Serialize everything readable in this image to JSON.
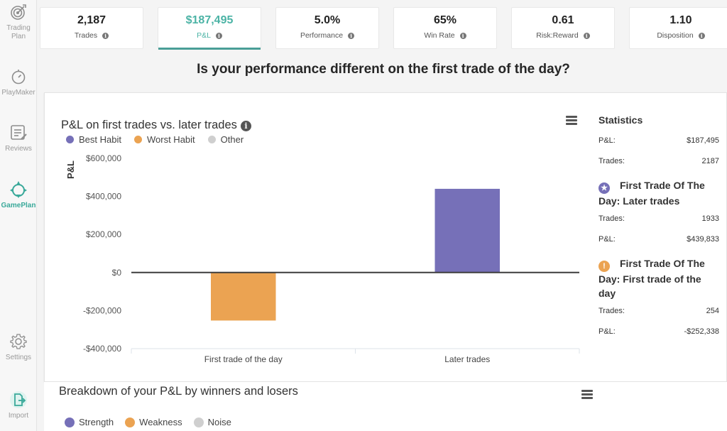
{
  "sidebar": {
    "items": [
      {
        "label": "Trading Plan",
        "icon": "target-icon",
        "active": false
      },
      {
        "label": "PlayMaker",
        "icon": "stopwatch-icon",
        "active": false
      },
      {
        "label": "Reviews",
        "icon": "review-list-icon",
        "active": false
      },
      {
        "label": "GamePlan",
        "icon": "compass-icon",
        "active": true
      },
      {
        "label": "Settings",
        "icon": "gear-icon",
        "active": false
      },
      {
        "label": "Import",
        "icon": "import-file-icon",
        "active": false
      }
    ]
  },
  "metrics": [
    {
      "value": "2,187",
      "label": "Trades",
      "active": false
    },
    {
      "value": "$187,495",
      "label": "P&L",
      "active": true
    },
    {
      "value": "5.0%",
      "label": "Performance",
      "active": false
    },
    {
      "value": "65%",
      "label": "Win Rate",
      "active": false
    },
    {
      "value": "0.61",
      "label": "Risk:Reward",
      "active": false
    },
    {
      "value": "1.10",
      "label": "Disposition",
      "active": false
    }
  ],
  "page_heading": "Is your performance different on the first trade of the day?",
  "colors": {
    "accent": "#4bb3a5",
    "best_habit": "#7670b8",
    "worst_habit": "#eba352",
    "other": "#cfcfcf"
  },
  "chart_data": {
    "type": "bar",
    "title": "P&L on first trades vs. later trades",
    "xlabel": "",
    "ylabel": "P&L",
    "categories": [
      "First trade of the day",
      "Later trades"
    ],
    "values": [
      -252338,
      439833
    ],
    "bar_series": [
      "Worst Habit",
      "Best Habit"
    ],
    "ylim": [
      -400000,
      600000
    ],
    "yticks": [
      600000,
      400000,
      200000,
      0,
      -200000,
      -400000
    ],
    "ytick_labels": [
      "$600,000",
      "$400,000",
      "$200,000",
      "$0",
      "-$200,000",
      "-$400,000"
    ],
    "legend": [
      {
        "name": "Best Habit",
        "color": "#7670b8"
      },
      {
        "name": "Worst Habit",
        "color": "#eba352"
      },
      {
        "name": "Other",
        "color": "#cfcfcf"
      }
    ],
    "legend_position": "top-left",
    "grid": false
  },
  "statistics": {
    "title": "Statistics",
    "overall": [
      {
        "key": "P&L:",
        "value": "$187,495"
      },
      {
        "key": "Trades:",
        "value": "2187"
      }
    ],
    "groups": [
      {
        "heading": "First Trade Of The Day: Later trades",
        "badge": "star-icon",
        "badge_glyph": "★",
        "rows": [
          {
            "key": "Trades:",
            "value": "1933"
          },
          {
            "key": "P&L:",
            "value": "$439,833"
          }
        ]
      },
      {
        "heading": "First Trade Of The Day: First trade of the day",
        "badge": "warning-icon",
        "badge_glyph": "!",
        "rows": [
          {
            "key": "Trades:",
            "value": "254"
          },
          {
            "key": "P&L:",
            "value": "-$252,338"
          }
        ]
      }
    ]
  },
  "breakdown": {
    "title": "Breakdown of your P&L by winners and losers",
    "legend": [
      {
        "name": "Strength",
        "color": "#7670b8"
      },
      {
        "name": "Weakness",
        "color": "#eba352"
      },
      {
        "name": "Noise",
        "color": "#cfcfcf"
      }
    ]
  },
  "info_glyph": "i"
}
